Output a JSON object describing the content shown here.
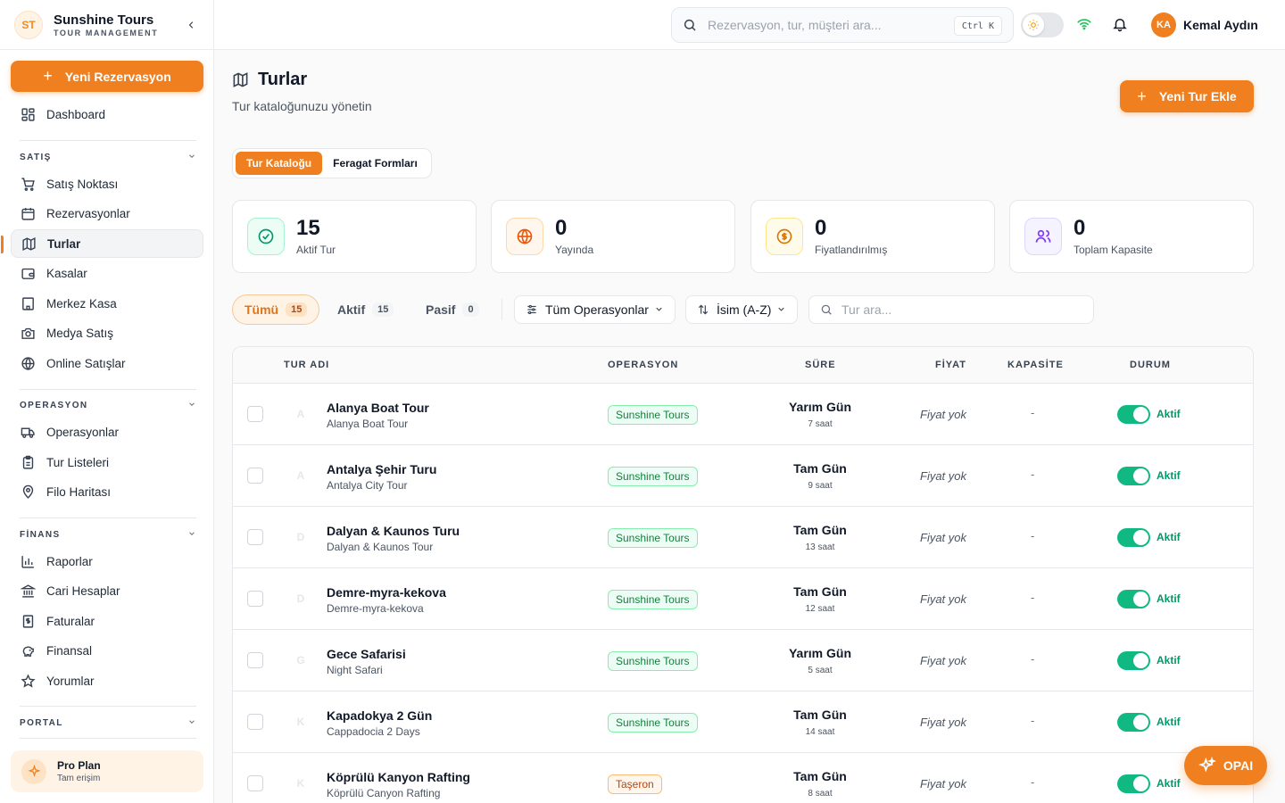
{
  "brand": {
    "logo": "ST",
    "name": "Sunshine Tours",
    "subtitle": "TOUR MANAGEMENT"
  },
  "sidebar": {
    "new_reservation": "Yeni Rezervasyon",
    "dashboard": "Dashboard",
    "sections": {
      "satis": "SATIŞ",
      "operasyon": "OPERASYON",
      "finans": "FİNANS",
      "portal": "PORTAL"
    },
    "items": {
      "satis_noktasi": "Satış Noktası",
      "rezervasyonlar": "Rezervasyonlar",
      "turlar": "Turlar",
      "kasalar": "Kasalar",
      "merkez_kasa": "Merkez Kasa",
      "medya_satis": "Medya Satış",
      "online_satislar": "Online Satışlar",
      "operasyonlar": "Operasyonlar",
      "tur_listeleri": "Tur Listeleri",
      "filo_haritasi": "Filo Haritası",
      "raporlar": "Raporlar",
      "cari_hesaplar": "Cari Hesaplar",
      "faturalar": "Faturalar",
      "finansal": "Finansal",
      "yorumlar": "Yorumlar"
    },
    "plan": {
      "title": "Pro Plan",
      "subtitle": "Tam erişim"
    }
  },
  "topbar": {
    "search_placeholder": "Rezervasyon, tur, müşteri ara...",
    "shortcut": "Ctrl K",
    "user": {
      "initials": "KA",
      "name": "Kemal Aydın"
    }
  },
  "page": {
    "title": "Turlar",
    "subtitle": "Tur kataloğunuzu yönetin",
    "add_button": "Yeni Tur Ekle",
    "tabs": [
      "Tur Kataloğu",
      "Feragat Formları"
    ]
  },
  "stats": [
    {
      "value": "15",
      "label": "Aktif Tur"
    },
    {
      "value": "0",
      "label": "Yayında"
    },
    {
      "value": "0",
      "label": "Fiyatlandırılmış"
    },
    {
      "value": "0",
      "label": "Toplam Kapasite"
    }
  ],
  "filters": {
    "all": {
      "label": "Tümü",
      "count": "15"
    },
    "active": {
      "label": "Aktif",
      "count": "15"
    },
    "passive": {
      "label": "Pasif",
      "count": "0"
    },
    "operations": "Tüm Operasyonlar",
    "sort": "İsim (A-Z)",
    "search_placeholder": "Tur ara..."
  },
  "table": {
    "headers": {
      "name": "TUR ADI",
      "operation": "OPERASYON",
      "duration": "SÜRE",
      "price": "FİYAT",
      "capacity": "KAPASİTE",
      "status": "DURUM"
    },
    "rows": [
      {
        "initial": "A",
        "name": "Alanya Boat Tour",
        "alt": "Alanya Boat Tour",
        "operation": "Sunshine Tours",
        "duration": "Yarım Gün",
        "hours": "7 saat",
        "price": "Fiyat yok",
        "capacity": "-",
        "status": "Aktif"
      },
      {
        "initial": "A",
        "name": "Antalya Şehir Turu",
        "alt": "Antalya City Tour",
        "operation": "Sunshine Tours",
        "duration": "Tam Gün",
        "hours": "9 saat",
        "price": "Fiyat yok",
        "capacity": "-",
        "status": "Aktif"
      },
      {
        "initial": "D",
        "name": "Dalyan & Kaunos Turu",
        "alt": "Dalyan & Kaunos Tour",
        "operation": "Sunshine Tours",
        "duration": "Tam Gün",
        "hours": "13 saat",
        "price": "Fiyat yok",
        "capacity": "-",
        "status": "Aktif"
      },
      {
        "initial": "D",
        "name": "Demre-myra-kekova",
        "alt": "Demre-myra-kekova",
        "operation": "Sunshine Tours",
        "duration": "Tam Gün",
        "hours": "12 saat",
        "price": "Fiyat yok",
        "capacity": "-",
        "status": "Aktif"
      },
      {
        "initial": "G",
        "name": "Gece Safarisi",
        "alt": "Night Safari",
        "operation": "Sunshine Tours",
        "duration": "Yarım Gün",
        "hours": "5 saat",
        "price": "Fiyat yok",
        "capacity": "-",
        "status": "Aktif"
      },
      {
        "initial": "K",
        "name": "Kapadokya 2 Gün",
        "alt": "Cappadocia 2 Days",
        "operation": "Sunshine Tours",
        "duration": "Tam Gün",
        "hours": "14 saat",
        "price": "Fiyat yok",
        "capacity": "-",
        "status": "Aktif"
      },
      {
        "initial": "K",
        "name": "Köprülü Kanyon Rafting",
        "alt": "Köprülü Canyon Rafting",
        "operation": "Taşeron",
        "duration": "Tam Gün",
        "hours": "8 saat",
        "price": "Fiyat yok",
        "capacity": "-",
        "status": "Aktif"
      }
    ]
  },
  "assistant": {
    "label": "OPAI"
  },
  "colors": {
    "accent": "#f07f1f",
    "success": "#10b981",
    "success_text": "#059669"
  }
}
